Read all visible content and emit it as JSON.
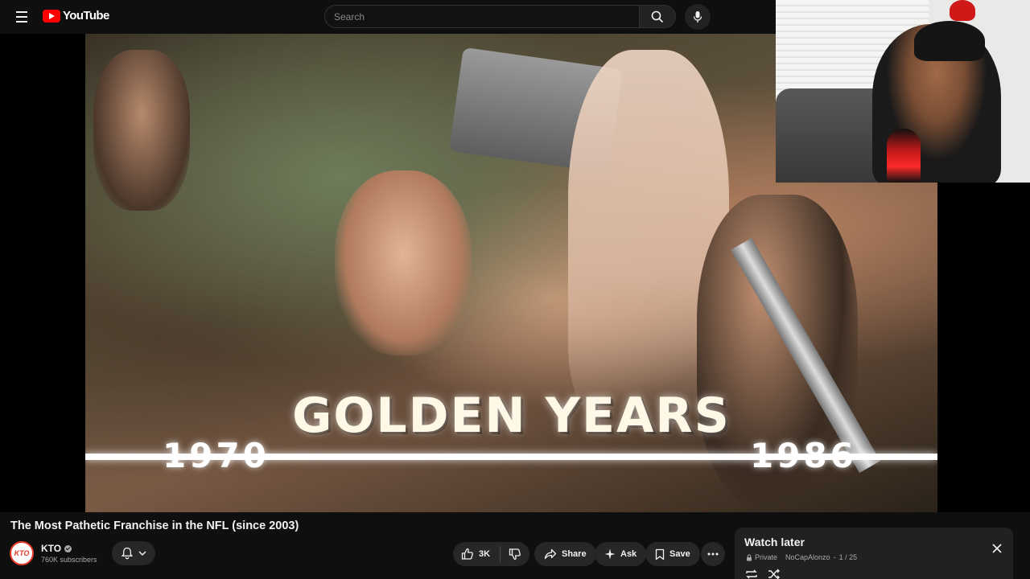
{
  "header": {
    "logo_text": "YouTube",
    "search_placeholder": "Search"
  },
  "video_frame": {
    "title_overlay": "GOLDEN YEARS",
    "year_start": "1970",
    "year_end": "1986"
  },
  "video": {
    "title": "The Most Pathetic Franchise in the NFL (since 2003)",
    "channel_avatar_text": "KTO",
    "channel_name": "KTO",
    "subscribers": "760K subscribers"
  },
  "actions": {
    "like_count": "3K",
    "share_label": "Share",
    "ask_label": "Ask",
    "save_label": "Save"
  },
  "playlist": {
    "title": "Watch later",
    "privacy": "Private",
    "owner": "NoCapAlonzo",
    "position": "1 / 25"
  },
  "colors": {
    "background": "#0f0f0f",
    "brand_red": "#ff0000",
    "pill_bg": "#272727",
    "panel_bg": "#212121"
  }
}
